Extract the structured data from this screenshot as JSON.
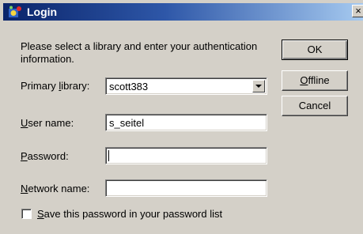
{
  "window": {
    "title": "Login",
    "close_label": "×"
  },
  "form": {
    "instructions": "Please select a library and enter your authentication information.",
    "primary_library": {
      "label_mnemonic": "Primary ",
      "label_hot": "l",
      "label_rest": "ibrary:",
      "value": "scott383"
    },
    "user_name": {
      "label_hot": "U",
      "label_rest": "ser name:",
      "value": "s_seitel"
    },
    "password": {
      "label_hot": "P",
      "label_rest": "assword:",
      "value": ""
    },
    "network_name": {
      "label_hot": "N",
      "label_rest": "etwork name:",
      "value": ""
    },
    "save_password": {
      "label_hot": "S",
      "label_rest": "ave this password in your password list",
      "checked": false
    }
  },
  "buttons": {
    "ok": "OK",
    "offline_hot": "O",
    "offline_rest": "ffline",
    "cancel": "Cancel"
  }
}
